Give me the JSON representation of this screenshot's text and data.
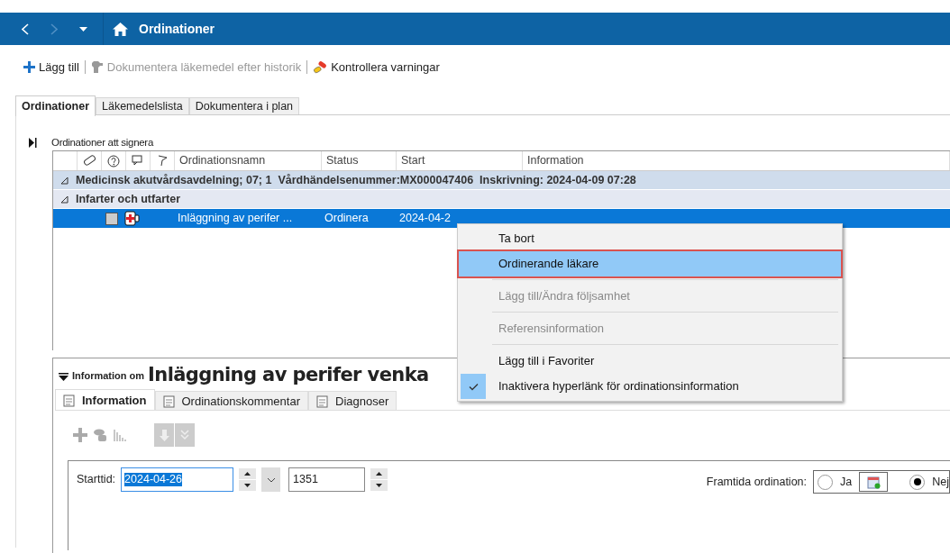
{
  "nav": {
    "title": "Ordinationer"
  },
  "toolbar": [
    {
      "kind": "add",
      "label": "Lägg till",
      "disabled": false
    },
    {
      "kind": "document",
      "label": "Dokumentera läkemedel efter historik",
      "disabled": true
    },
    {
      "kind": "warnings",
      "label": "Kontrollera varningar",
      "disabled": false
    }
  ],
  "tabs": [
    {
      "label": "Ordinationer",
      "selected": true
    },
    {
      "label": "Läkemedelslista",
      "selected": false
    },
    {
      "label": "Dokumentera i plan",
      "selected": false
    }
  ],
  "section_title": "Ordinationer att signera",
  "grid": {
    "columns": [
      "Ordinationsnamn",
      "Status",
      "Start",
      "Information"
    ],
    "groups": [
      {
        "label": "Medicinsk akutvårdsavdelning; 07; 1  Vårdhändelsenummer:MX000047406  Inskrivning: 2024-04-09 07:28",
        "expanded": true,
        "kind": "department"
      },
      {
        "label": "Infarter och utfarter",
        "expanded": true,
        "kind": "category"
      }
    ],
    "rows": [
      {
        "checked": false,
        "selected": true,
        "name": "Inläggning av perifer ...",
        "status": "Ordinera",
        "start": "2024-04-2"
      }
    ]
  },
  "context_menu": [
    {
      "label": "Ta bort",
      "disabled": false,
      "selected": false,
      "checked": false,
      "separator_before": false
    },
    {
      "label": "Ordinerande läkare",
      "disabled": false,
      "selected": true,
      "checked": false,
      "separator_before": false
    },
    {
      "label": "Lägg till/Ändra följsamhet",
      "disabled": true,
      "selected": false,
      "checked": false,
      "separator_before": true
    },
    {
      "label": "Referensinformation",
      "disabled": true,
      "selected": false,
      "checked": false,
      "separator_before": true
    },
    {
      "label": "Lägg till i Favoriter",
      "disabled": false,
      "selected": false,
      "checked": false,
      "separator_before": true
    },
    {
      "label": "Inaktivera hyperlänk för ordinationsinformation",
      "disabled": false,
      "selected": false,
      "checked": true,
      "separator_before": false
    }
  ],
  "detail": {
    "title_prefix": "Information om",
    "title": "Inläggning av perifer venka",
    "tabs": [
      {
        "label": "Information",
        "selected": true
      },
      {
        "label": "Ordinationskommentar",
        "selected": false
      },
      {
        "label": "Diagnoser",
        "selected": false
      }
    ],
    "start_label": "Starttid:",
    "start_date": "2024-04-26",
    "start_time": "1351",
    "future_label": "Framtida ordination:",
    "future_options": [
      {
        "label": "Ja",
        "selected": false
      },
      {
        "label": "Nej",
        "selected": true
      }
    ]
  }
}
